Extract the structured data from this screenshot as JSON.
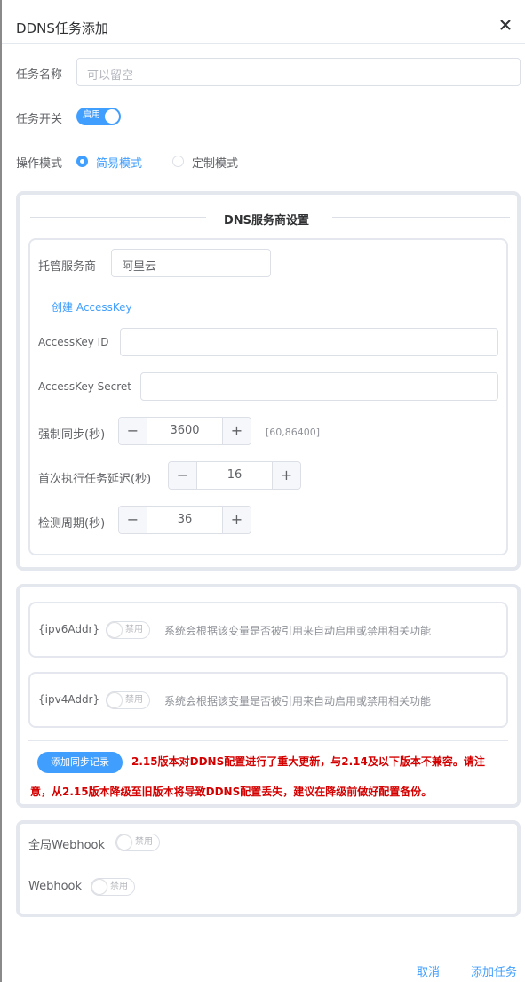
{
  "dialog": {
    "title": "DDNS任务添加"
  },
  "icons": {
    "close": "close-icon",
    "minus": "minus-icon",
    "plus": "plus-icon"
  },
  "colors": {
    "primary": "#409eff",
    "warning": "#d40000",
    "border": "#e4e7ed"
  },
  "form": {
    "task_name_label": "任务名称",
    "task_name_placeholder": "可以留空",
    "task_switch_label": "任务开关",
    "task_switch_text": "启用",
    "task_switch_on": true,
    "mode_label": "操作模式",
    "mode_options": [
      "简易模式",
      "定制模式"
    ],
    "mode_selected": "简易模式"
  },
  "dns": {
    "section_title": "DNS服务商设置",
    "provider_label": "托管服务商",
    "provider_value": "阿里云",
    "create_key_link": "创建 AccessKey",
    "access_key_id_label": "AccessKey ID",
    "access_key_secret_label": "AccessKey Secret",
    "force_sync_label": "强制同步(秒)",
    "force_sync_value": "3600",
    "force_sync_range": "[60,86400]",
    "first_delay_label": "首次执行任务延迟(秒)",
    "first_delay_value": "16",
    "check_period_label": "检测周期(秒)",
    "check_period_value": "36"
  },
  "records": {
    "ipv6_label": "{ipv6Addr}",
    "ipv6_switch": "禁用",
    "ipv6_desc": "系统会根据该变量是否被引用来自动启用或禁用相关功能",
    "ipv4_label": "{ipv4Addr}",
    "ipv4_switch": "禁用",
    "ipv4_desc": "系统会根据该变量是否被引用来自动启用或禁用相关功能",
    "add_button": "添加同步记录",
    "warning_line1": "2.15版本对DDNS配置进行了重大更新，与2.14及以下版本不兼容。请注",
    "warning_line2": "意，从2.15版本降级至旧版本将导致DDNS配置丢失，建议在降级前做好配置备份。"
  },
  "webhook": {
    "global_label": "全局Webhook",
    "global_switch": "禁用",
    "webhook_label": "Webhook",
    "webhook_switch": "禁用"
  },
  "footer": {
    "cancel": "取消",
    "submit": "添加任务"
  }
}
